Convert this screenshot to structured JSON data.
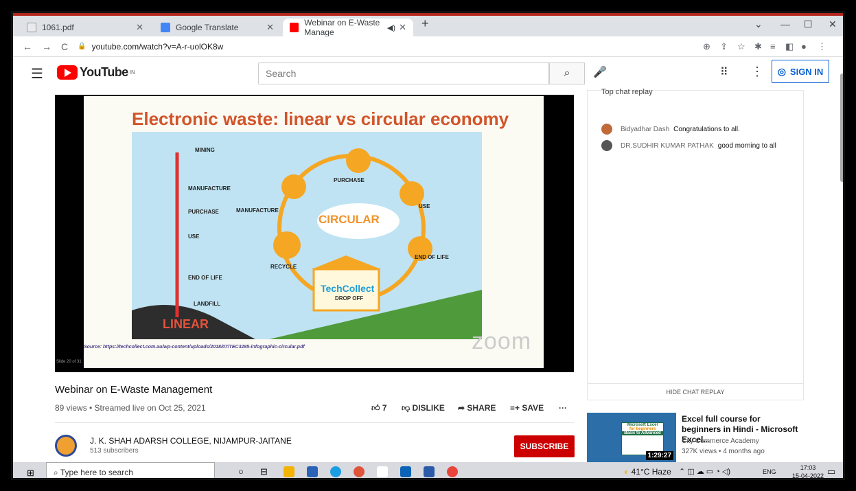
{
  "browser": {
    "tabs": [
      {
        "label": "1061.pdf"
      },
      {
        "label": "Google Translate"
      },
      {
        "label": "Webinar on E-Waste Manage"
      }
    ],
    "url": "youtube.com/watch?v=A-r-uolOK8w"
  },
  "youtube": {
    "logo_text": "YouTube",
    "region": "IN",
    "search_placeholder": "Search",
    "sign_in": "SIGN IN"
  },
  "slide": {
    "title": "Electronic waste: linear vs circular economy",
    "circular_label": "CIRCULAR",
    "linear_label": "LINEAR",
    "linear_steps": [
      "MINING",
      "MANUFACTURE",
      "PURCHASE",
      "USE",
      "END OF LIFE",
      "LANDFILL"
    ],
    "circular_steps": [
      "PURCHASE",
      "MANUFACTURE",
      "USE",
      "END OF LIFE",
      "RECYCLE"
    ],
    "techcollect": "TechCollect",
    "dropoff": "DROP OFF",
    "source": "Source: https://techcollect.com.au/wp-content/uploads/2018/07/TEC3285-infographic-circular.pdf",
    "watermark": "zoom",
    "slide_number": "Slide 20 of 31"
  },
  "video": {
    "title": "Webinar on E-Waste Management",
    "meta": "89 views • Streamed live on Oct 25, 2021",
    "likes": "7",
    "dislike": "DISLIKE",
    "share": "SHARE",
    "save": "SAVE"
  },
  "channel": {
    "name": "J. K. SHAH ADARSH COLLEGE, NIJAMPUR-JAITANE",
    "subscribers": "513 subscribers",
    "subscribe": "SUBSCRIBE"
  },
  "chat": {
    "header": "Top chat replay",
    "messages": [
      {
        "author": "Bidyadhar Dash",
        "text": "Congratulations to all."
      },
      {
        "author": "DR.SUDHIR KUMAR PATHAK",
        "text": "good morning to all"
      }
    ],
    "hide": "HIDE CHAT REPLAY"
  },
  "recommended": {
    "title": "Excel full course for beginners in Hindi - Microsoft Excel...",
    "channel": "City Commerce Academy",
    "meta": "327K views • 4 months ago",
    "duration": "1:29:27",
    "thumb_text": "Microsoft Excel",
    "thumb_sub": "for beginners",
    "thumb_sub2": "Basic to Advanced"
  },
  "taskbar": {
    "search": "Type here to search",
    "weather": "41°C Haze",
    "lang": "ENG",
    "time": "17:03",
    "date": "15-04-2022"
  },
  "colors": {
    "youtube_red": "#ff0000",
    "subscribe_red": "#cc0000",
    "signin_blue": "#065fd4",
    "slide_title": "#d2542a",
    "circular_orange": "#f0932b"
  }
}
